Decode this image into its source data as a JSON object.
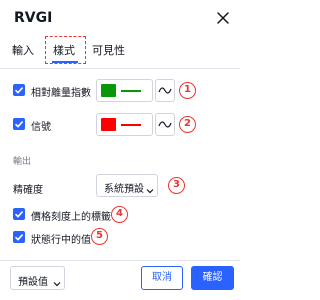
{
  "dialog": {
    "title": "RVGI"
  },
  "tabs": [
    {
      "label": "輸入"
    },
    {
      "label": "樣式",
      "active": true
    },
    {
      "label": "可見性"
    }
  ],
  "plots": [
    {
      "label": "相對離量指數",
      "checked": true,
      "color": "#089807",
      "line_color": "#089807"
    },
    {
      "label": "信號",
      "checked": true,
      "color": "#ff0000",
      "line_color": "#ff0000"
    }
  ],
  "output": {
    "section_label": "輸出",
    "precision_label": "精確度",
    "precision_value": "系統預設"
  },
  "options": [
    {
      "label": "價格刻度上的標籤",
      "checked": true
    },
    {
      "label": "狀態行中的值",
      "checked": true
    }
  ],
  "footer": {
    "template_label": "預設值",
    "cancel_label": "取消",
    "ok_label": "確認"
  },
  "annotations": [
    "1",
    "2",
    "3",
    "4",
    "5"
  ],
  "colors": {
    "accent": "#2962ff",
    "annotation": "#e53935"
  }
}
